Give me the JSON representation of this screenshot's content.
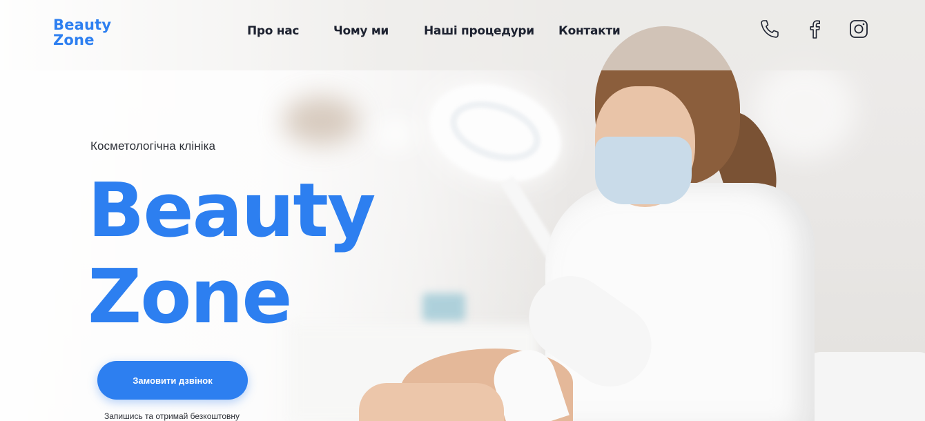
{
  "header": {
    "logo_line1": "Beauty",
    "logo_line2": "Zone",
    "nav": [
      {
        "label": "Про нас"
      },
      {
        "label": "Чому ми"
      },
      {
        "label": "Наші процедури"
      },
      {
        "label": "Контакти"
      }
    ],
    "social_icons": [
      "phone-icon",
      "facebook-icon",
      "instagram-icon"
    ]
  },
  "hero": {
    "subtitle": "Косметологічна клініка",
    "title_line1": "Beauty",
    "title_line2": "Zone",
    "cta_label": "Замовити дзвінок",
    "cta_note": "Запишись та отримай безкоштовну"
  },
  "colors": {
    "accent": "#2d7ff0",
    "text_dark": "#1d2230"
  }
}
